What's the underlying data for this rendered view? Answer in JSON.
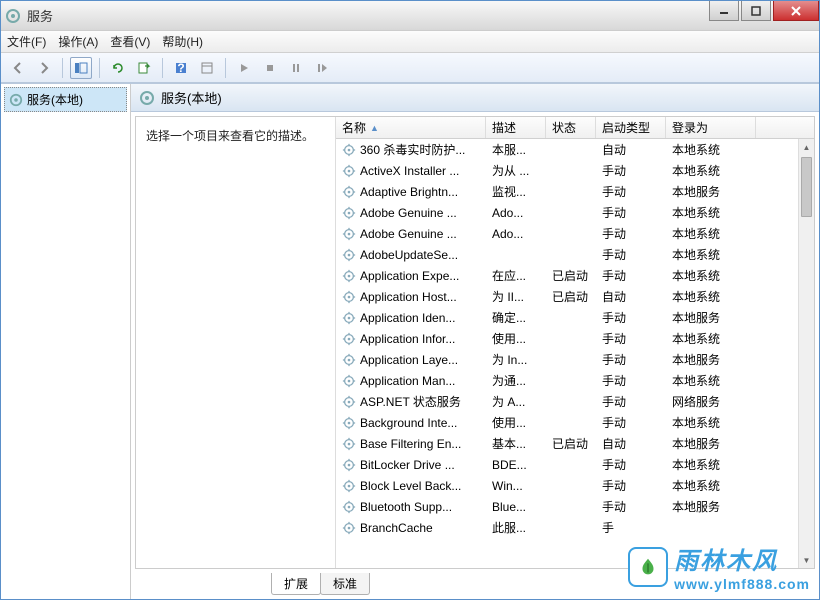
{
  "window": {
    "title": "服务"
  },
  "menu": {
    "file": "文件(F)",
    "action": "操作(A)",
    "view": "查看(V)",
    "help": "帮助(H)"
  },
  "tree": {
    "root": "服务(本地)"
  },
  "header": {
    "title": "服务(本地)"
  },
  "desc_pane": {
    "prompt": "选择一个项目来查看它的描述。"
  },
  "columns": {
    "name": "名称",
    "desc": "描述",
    "status": "状态",
    "startup": "启动类型",
    "logon": "登录为"
  },
  "services": [
    {
      "name": "360 杀毒实时防护...",
      "desc": "本服...",
      "status": "",
      "startup": "自动",
      "logon": "本地系统"
    },
    {
      "name": "ActiveX Installer ...",
      "desc": "为从 ...",
      "status": "",
      "startup": "手动",
      "logon": "本地系统"
    },
    {
      "name": "Adaptive Brightn...",
      "desc": "监视...",
      "status": "",
      "startup": "手动",
      "logon": "本地服务"
    },
    {
      "name": "Adobe Genuine ...",
      "desc": "Ado...",
      "status": "",
      "startup": "手动",
      "logon": "本地系统"
    },
    {
      "name": "Adobe Genuine ...",
      "desc": "Ado...",
      "status": "",
      "startup": "手动",
      "logon": "本地系统"
    },
    {
      "name": "AdobeUpdateSe...",
      "desc": "",
      "status": "",
      "startup": "手动",
      "logon": "本地系统"
    },
    {
      "name": "Application Expe...",
      "desc": "在应...",
      "status": "已启动",
      "startup": "手动",
      "logon": "本地系统"
    },
    {
      "name": "Application Host...",
      "desc": "为 II...",
      "status": "已启动",
      "startup": "自动",
      "logon": "本地系统"
    },
    {
      "name": "Application Iden...",
      "desc": "确定...",
      "status": "",
      "startup": "手动",
      "logon": "本地服务"
    },
    {
      "name": "Application Infor...",
      "desc": "使用...",
      "status": "",
      "startup": "手动",
      "logon": "本地系统"
    },
    {
      "name": "Application Laye...",
      "desc": "为 In...",
      "status": "",
      "startup": "手动",
      "logon": "本地服务"
    },
    {
      "name": "Application Man...",
      "desc": "为通...",
      "status": "",
      "startup": "手动",
      "logon": "本地系统"
    },
    {
      "name": "ASP.NET 状态服务",
      "desc": "为 A...",
      "status": "",
      "startup": "手动",
      "logon": "网络服务"
    },
    {
      "name": "Background Inte...",
      "desc": "使用...",
      "status": "",
      "startup": "手动",
      "logon": "本地系统"
    },
    {
      "name": "Base Filtering En...",
      "desc": "基本...",
      "status": "已启动",
      "startup": "自动",
      "logon": "本地服务"
    },
    {
      "name": "BitLocker Drive ...",
      "desc": "BDE...",
      "status": "",
      "startup": "手动",
      "logon": "本地系统"
    },
    {
      "name": "Block Level Back...",
      "desc": "Win...",
      "status": "",
      "startup": "手动",
      "logon": "本地系统"
    },
    {
      "name": "Bluetooth Supp...",
      "desc": "Blue...",
      "status": "",
      "startup": "手动",
      "logon": "本地服务"
    },
    {
      "name": "BranchCache",
      "desc": "此服...",
      "status": "",
      "startup": "手",
      "logon": ""
    }
  ],
  "tabs": {
    "extended": "扩展",
    "standard": "标准"
  },
  "watermark": {
    "zh": "雨林木风",
    "url": "www.ylmf888.com"
  }
}
